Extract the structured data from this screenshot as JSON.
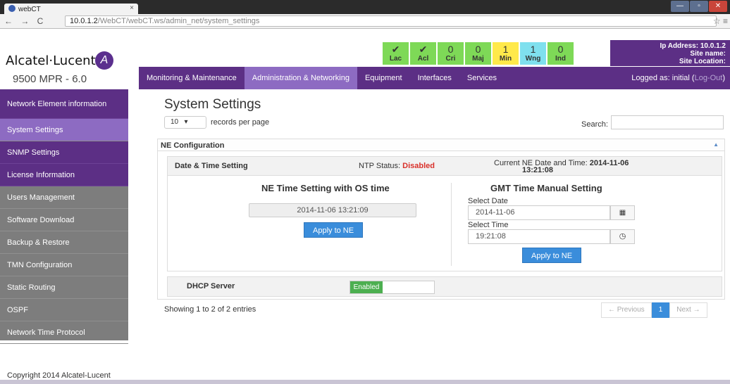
{
  "browser": {
    "tab_title": "webCT",
    "tab_close": "×",
    "nav_glyphs": "← → C",
    "url_host": "10.0.1.2",
    "url_path": "/WebCT/webCT.ws/admin_net/system_settings",
    "star": "☆ ≡",
    "win_buttons": [
      "—",
      "▫",
      "✕"
    ]
  },
  "brand": {
    "logo_text": "Alcatel·Lucent",
    "logo_mark": "A",
    "model": "9500 MPR - 6.0"
  },
  "alarms": [
    {
      "value": "✔",
      "label": "Lac",
      "color": "#7ed957"
    },
    {
      "value": "✔",
      "label": "Acl",
      "color": "#7ed957"
    },
    {
      "value": "0",
      "label": "Cri",
      "color": "#7ed957"
    },
    {
      "value": "0",
      "label": "Maj",
      "color": "#7ed957"
    },
    {
      "value": "1",
      "label": "Min",
      "color": "#ffe94a"
    },
    {
      "value": "1",
      "label": "Wng",
      "color": "#7fe0ee"
    },
    {
      "value": "0",
      "label": "Ind",
      "color": "#7ed957"
    }
  ],
  "ipinfo": {
    "line1": "Ip Address:  10.0.1.2",
    "line2": "Site name:",
    "line3": "Site Location:"
  },
  "topnav": {
    "items": [
      "Monitoring & Maintenance",
      "Administration & Networking",
      "Equipment",
      "Interfaces",
      "Services"
    ],
    "logged_prefix": "Logged as: initial (",
    "logout": "Log-Out",
    "logged_suffix": ")"
  },
  "sidebar": {
    "items": [
      "Network Element information",
      "System Settings",
      "SNMP Settings",
      "License Information",
      "Users Management",
      "Software Download",
      "Backup & Restore",
      "TMN Configuration",
      "Static Routing",
      "OSPF",
      "Network Time Protocol"
    ]
  },
  "main": {
    "title": "System Settings",
    "rpp_value": "10",
    "rpp_caret": "▾",
    "rpp_label": "records per page",
    "search_label": "Search:"
  },
  "panel": {
    "title": "NE Configuration",
    "caret": "▲",
    "dt_label": "Date & Time Setting",
    "ntp_label": "NTP Status: ",
    "ntp_value": "Disabled",
    "curdt_label": "Current NE Date and Time: ",
    "curdt_date": "2014-11-06",
    "curdt_time": "13:21:08",
    "os_title": "NE Time Setting with OS time",
    "os_time": "2014-11-06 13:21:09",
    "apply": "Apply to NE",
    "gmt_title": "GMT Time Manual Setting",
    "select_date": "Select Date",
    "date_value": "2014-11-06",
    "calendar_glyph": "▦",
    "select_time": "Select Time",
    "time_value": "19:21:08",
    "clock_glyph": "◷",
    "dhcp_label": "DHCP Server",
    "dhcp_state": "Enabled"
  },
  "table_footer": {
    "showing": "Showing 1 to 2 of 2 entries",
    "prev": "← Previous",
    "page": "1",
    "next": "Next →"
  },
  "footer": {
    "copyright": "Copyright 2014 Alcatel-Lucent"
  }
}
